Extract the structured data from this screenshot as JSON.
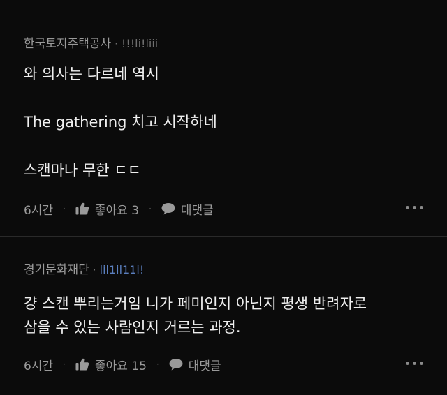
{
  "comments": [
    {
      "author": "한국토지주택공사",
      "separator": "·",
      "handle": "!!!li!liii",
      "lines": [
        "와 의사는 다르네 역시",
        "The gathering 치고 시작하네",
        "스캔마나 무한 ㄷㄷ"
      ],
      "time": "6시간",
      "like_label": "좋아요 3",
      "reply_label": "대댓글"
    },
    {
      "author": "경기문화재단",
      "separator": "·",
      "handle": "lil1il11i!",
      "lines": [
        "걍 스캔 뿌리는거임  니가 페미인지 아닌지  평생 반려자로",
        "삼을 수 있는 사람인지 거르는 과정."
      ],
      "time": "6시간",
      "like_label": "좋아요 15",
      "reply_label": "대댓글"
    }
  ],
  "footer_separator": "·",
  "icons": {
    "like": "thumbs-up-icon",
    "reply": "speech-bubble-icon",
    "more": "more-dots-icon"
  },
  "colors": {
    "background": "#0b0b0b",
    "handle_gray": "#6f6f6f",
    "handle_blue": "#5b7fbe"
  }
}
